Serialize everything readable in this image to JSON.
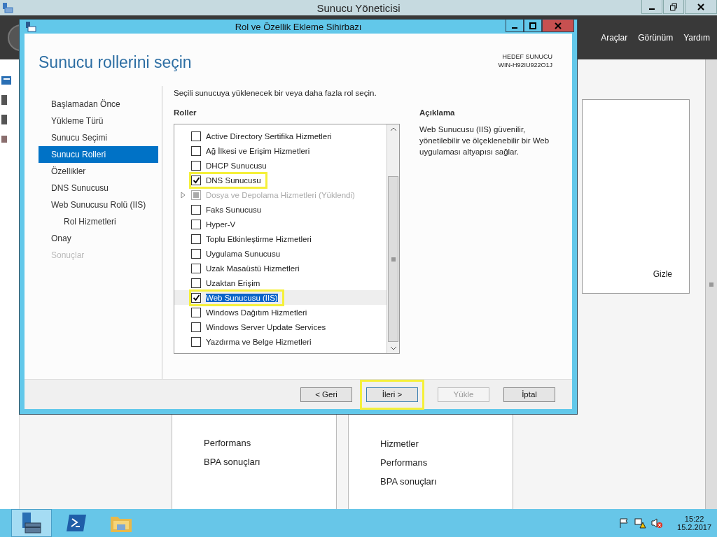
{
  "app": {
    "title": "Sunucu Yöneticisi",
    "menu": [
      "Araçlar",
      "Görünüm",
      "Yardım"
    ],
    "hide_link": "Gizle",
    "tiles": [
      {
        "items": [
          "Performans",
          "BPA sonuçları"
        ]
      },
      {
        "items": [
          "Hizmetler",
          "Performans",
          "BPA sonuçları"
        ]
      }
    ]
  },
  "dialog": {
    "title": "Rol ve Özellik Ekleme Sihirbazı",
    "heading": "Sunucu rollerini seçin",
    "target_label": "HEDEF SUNUCU",
    "target_name": "WIN-H92IU922O1J",
    "steps": [
      {
        "label": "Başlamadan Önce",
        "selected": false,
        "disabled": false
      },
      {
        "label": "Yükleme Türü",
        "selected": false,
        "disabled": false
      },
      {
        "label": "Sunucu Seçimi",
        "selected": false,
        "disabled": false
      },
      {
        "label": "Sunucu Rolleri",
        "selected": true,
        "disabled": false
      },
      {
        "label": "Özellikler",
        "selected": false,
        "disabled": false
      },
      {
        "label": "DNS Sunucusu",
        "selected": false,
        "disabled": false
      },
      {
        "label": "Web Sunucusu Rolü (IIS)",
        "selected": false,
        "disabled": false,
        "children": [
          {
            "label": "Rol Hizmetleri",
            "selected": false,
            "disabled": false
          }
        ]
      },
      {
        "label": "Onay",
        "selected": false,
        "disabled": false
      },
      {
        "label": "Sonuçlar",
        "selected": false,
        "disabled": true
      }
    ],
    "instruction": "Seçili sunucuya yüklenecek bir veya daha fazla rol seçin.",
    "roles_heading": "Roller",
    "roles": [
      {
        "label": "Active Directory Sertifika Hizmetleri",
        "checked": false,
        "disabled": false,
        "selected": false,
        "highlighted": false
      },
      {
        "label": "Ağ İlkesi ve Erişim Hizmetleri",
        "checked": false,
        "disabled": false,
        "selected": false,
        "highlighted": false
      },
      {
        "label": "DHCP Sunucusu",
        "checked": false,
        "disabled": false,
        "selected": false,
        "highlighted": false
      },
      {
        "label": "DNS Sunucusu",
        "checked": true,
        "disabled": false,
        "selected": false,
        "highlighted": true
      },
      {
        "label": "Dosya ve Depolama Hizmetleri (Yüklendi)",
        "checked": false,
        "disabled": true,
        "selected": false,
        "highlighted": false,
        "expandable": true
      },
      {
        "label": "Faks Sunucusu",
        "checked": false,
        "disabled": false,
        "selected": false,
        "highlighted": false
      },
      {
        "label": "Hyper-V",
        "checked": false,
        "disabled": false,
        "selected": false,
        "highlighted": false
      },
      {
        "label": "Toplu Etkinleştirme Hizmetleri",
        "checked": false,
        "disabled": false,
        "selected": false,
        "highlighted": false
      },
      {
        "label": "Uygulama Sunucusu",
        "checked": false,
        "disabled": false,
        "selected": false,
        "highlighted": false
      },
      {
        "label": "Uzak Masaüstü Hizmetleri",
        "checked": false,
        "disabled": false,
        "selected": false,
        "highlighted": false
      },
      {
        "label": "Uzaktan Erişim",
        "checked": false,
        "disabled": false,
        "selected": false,
        "highlighted": false
      },
      {
        "label": "Web Sunucusu (IIS)",
        "checked": true,
        "disabled": false,
        "selected": true,
        "highlighted": true
      },
      {
        "label": "Windows Dağıtım Hizmetleri",
        "checked": false,
        "disabled": false,
        "selected": false,
        "highlighted": false
      },
      {
        "label": "Windows Server Update Services",
        "checked": false,
        "disabled": false,
        "selected": false,
        "highlighted": false
      },
      {
        "label": "Yazdırma ve Belge Hizmetleri",
        "checked": false,
        "disabled": false,
        "selected": false,
        "highlighted": false
      }
    ],
    "description_heading": "Açıklama",
    "description": "Web Sunucusu (IIS) güvenilir, yönetilebilir ve ölçeklenebilir bir Web uygulaması altyapısı sağlar.",
    "buttons": [
      {
        "label": "< Geri",
        "disabled": false,
        "highlighted": false
      },
      {
        "label": "İleri >",
        "disabled": false,
        "highlighted": true
      },
      {
        "label": "Yükle",
        "disabled": true,
        "highlighted": false
      },
      {
        "label": "İptal",
        "disabled": false,
        "highlighted": false
      }
    ]
  },
  "taskbar": {
    "time": "15:22",
    "date": "15.2.2017"
  }
}
